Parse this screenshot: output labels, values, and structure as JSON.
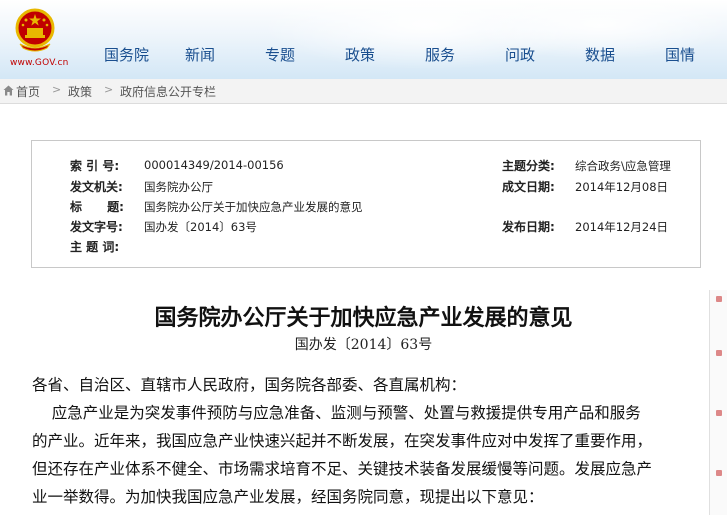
{
  "site": {
    "url_text": "www.GOV.cn"
  },
  "nav": {
    "items": [
      {
        "label": "国务院"
      },
      {
        "label": "新闻"
      },
      {
        "label": "专题"
      },
      {
        "label": "政策"
      },
      {
        "label": "服务"
      },
      {
        "label": "问政"
      },
      {
        "label": "数据"
      },
      {
        "label": "国情"
      }
    ]
  },
  "breadcrumb": {
    "items": [
      {
        "label": "首页"
      },
      {
        "label": "政策"
      },
      {
        "label": "政府信息公开专栏"
      }
    ],
    "separator": ">"
  },
  "info": {
    "index_label": "索 引 号:",
    "index_value": "000014349/2014-00156",
    "category_label": "主题分类:",
    "category_value": "综合政务\\应急管理",
    "issuer_label": "发文机关:",
    "issuer_value": "国务院办公厅",
    "created_label": "成文日期:",
    "created_value": "2014年12月08日",
    "title_label": "标      题:",
    "title_value": "国务院办公厅关于加快应急产业发展的意见",
    "docno_label": "发文字号:",
    "docno_value": "国办发〔2014〕63号",
    "published_label": "发布日期:",
    "published_value": "2014年12月24日",
    "keywords_label": "主 题 词:",
    "keywords_value": ""
  },
  "document": {
    "title": "国务院办公厅关于加快应急产业发展的意见",
    "number": "国办发〔2014〕63号",
    "salutation": "各省、自治区、直辖市人民政府，国务院各部委、各直属机构：",
    "body_lines": [
      "    应急产业是为突发事件预防与应急准备、监测与预警、处置与救援提供专用产品和服务",
      "的产业。近年来，我国应急产业快速兴起并不断发展，在突发事件应对中发挥了重要作用，",
      "但还存在产业体系不健全、市场需求培育不足、关键技术装备发展缓慢等问题。发展应急产",
      "业一举数得。为加快我国应急产业发展，经国务院同意，现提出以下意见："
    ]
  },
  "colors": {
    "nav_text": "#1a4f8f",
    "emblem_red": "#c00000",
    "emblem_gold": "#e8b800"
  },
  "icons": {
    "emblem": "national-emblem-icon",
    "home": "home-icon"
  }
}
